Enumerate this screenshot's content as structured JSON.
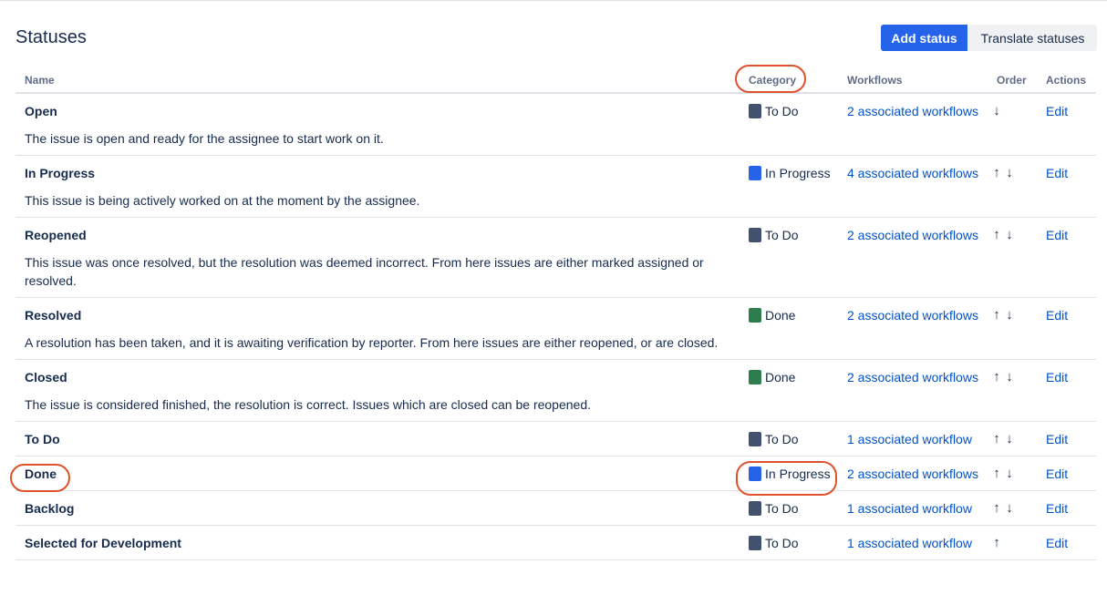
{
  "page": {
    "title": "Statuses"
  },
  "toolbar": {
    "add_status": "Add status",
    "translate_statuses": "Translate statuses"
  },
  "table": {
    "headers": {
      "name": "Name",
      "category": "Category",
      "workflows": "Workflows",
      "order": "Order",
      "actions": "Actions"
    },
    "rows": [
      {
        "name": "Open",
        "description": "The issue is open and ready for the assignee to start work on it.",
        "category": "To Do",
        "category_color": "#42526e",
        "workflows": "2 associated workflows",
        "up": "",
        "down": "↓",
        "action": "Edit"
      },
      {
        "name": "In Progress",
        "description": "This issue is being actively worked on at the moment by the assignee.",
        "category": "In Progress",
        "category_color": "#2563eb",
        "workflows": "4 associated workflows",
        "up": "↑",
        "down": "↓",
        "action": "Edit"
      },
      {
        "name": "Reopened",
        "description": "This issue was once resolved, but the resolution was deemed incorrect. From here issues are either marked assigned or resolved.",
        "category": "To Do",
        "category_color": "#42526e",
        "workflows": "2 associated workflows",
        "up": "↑",
        "down": "↓",
        "action": "Edit"
      },
      {
        "name": "Resolved",
        "description": "A resolution has been taken, and it is awaiting verification by reporter. From here issues are either reopened, or are closed.",
        "category": "Done",
        "category_color": "#2e7d4f",
        "workflows": "2 associated workflows",
        "up": "↑",
        "down": "↓",
        "action": "Edit"
      },
      {
        "name": "Closed",
        "description": "The issue is considered finished, the resolution is correct. Issues which are closed can be reopened.",
        "category": "Done",
        "category_color": "#2e7d4f",
        "workflows": "2 associated workflows",
        "up": "↑",
        "down": "↓",
        "action": "Edit"
      },
      {
        "name": "To Do",
        "description": "",
        "category": "To Do",
        "category_color": "#42526e",
        "workflows": "1 associated workflow",
        "up": "↑",
        "down": "↓",
        "action": "Edit"
      },
      {
        "name": "Done",
        "description": "",
        "category": "In Progress",
        "category_color": "#2563eb",
        "workflows": "2 associated workflows",
        "up": "↑",
        "down": "↓",
        "action": "Edit"
      },
      {
        "name": "Backlog",
        "description": "",
        "category": "To Do",
        "category_color": "#42526e",
        "workflows": "1 associated workflow",
        "up": "↑",
        "down": "↓",
        "action": "Edit"
      },
      {
        "name": "Selected for Development",
        "description": "",
        "category": "To Do",
        "category_color": "#42526e",
        "workflows": "1 associated workflow",
        "up": "↑",
        "down": "",
        "action": "Edit"
      }
    ]
  },
  "colors": {
    "primary": "#2563eb",
    "link": "#0052cc",
    "highlight": "#e0522e"
  }
}
